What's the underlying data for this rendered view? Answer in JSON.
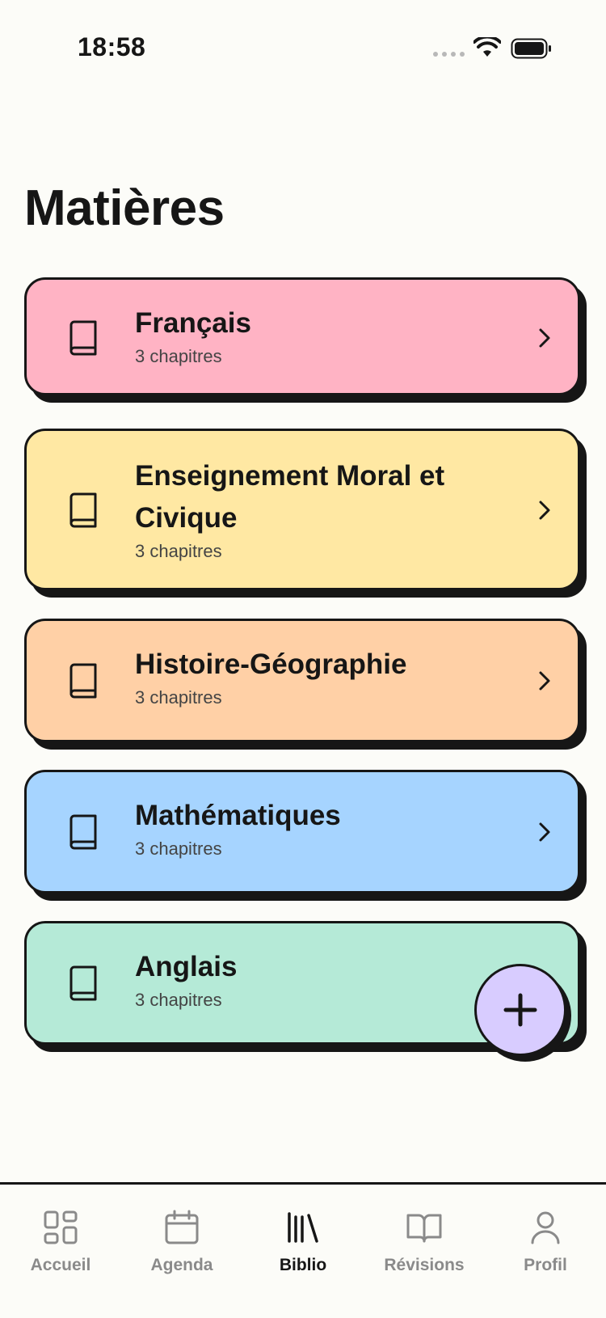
{
  "status": {
    "time": "18:58"
  },
  "page": {
    "title": "Matières"
  },
  "subjects": [
    {
      "title": "Français",
      "subtitle": "3 chapitres",
      "color": "#ffb3c4"
    },
    {
      "title": "Enseignement Moral et Civique",
      "subtitle": "3 chapitres",
      "color": "#ffe8a3"
    },
    {
      "title": "Histoire-Géographie",
      "subtitle": "3 chapitres",
      "color": "#ffd0a6"
    },
    {
      "title": "Mathématiques",
      "subtitle": "3 chapitres",
      "color": "#a6d4ff"
    },
    {
      "title": "Anglais",
      "subtitle": "3 chapitres",
      "color": "#b5ead7"
    }
  ],
  "fab": {
    "icon": "plus-icon",
    "color": "#d8ccff"
  },
  "nav": [
    {
      "label": "Accueil",
      "icon": "grid-icon",
      "active": false
    },
    {
      "label": "Agenda",
      "icon": "calendar-icon",
      "active": false
    },
    {
      "label": "Biblio",
      "icon": "library-icon",
      "active": true
    },
    {
      "label": "Révisions",
      "icon": "open-book-icon",
      "active": false
    },
    {
      "label": "Profil",
      "icon": "user-icon",
      "active": false
    }
  ]
}
